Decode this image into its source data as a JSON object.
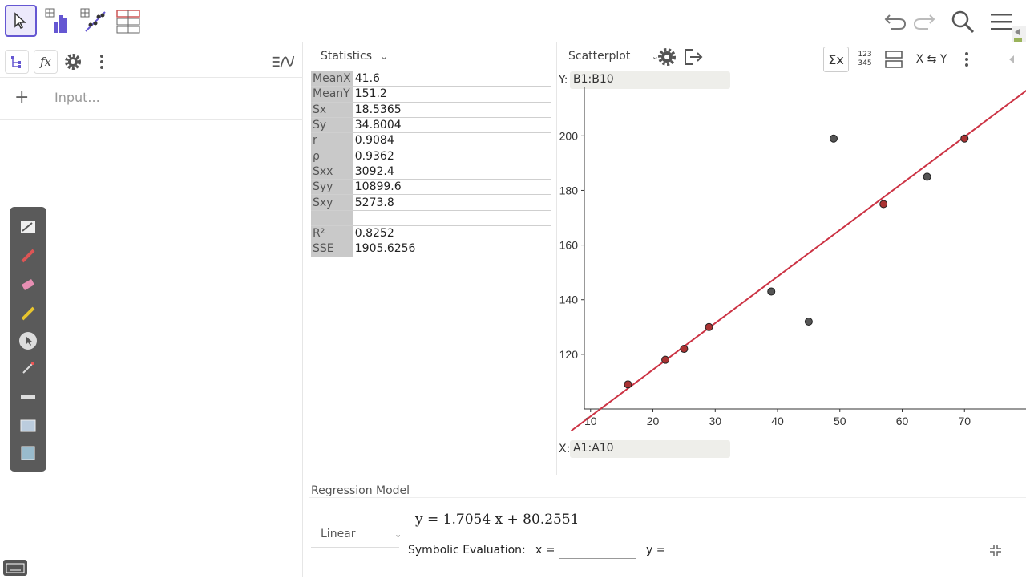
{
  "toolbar": {
    "tools": [
      "move-tool",
      "one-variable-tool",
      "two-variable-tool",
      "multi-variable-tool"
    ],
    "right": [
      "undo",
      "redo",
      "search",
      "menu"
    ]
  },
  "algebra": {
    "input_placeholder": "Input..."
  },
  "statistics": {
    "title": "Statistics",
    "rows": [
      {
        "label": "MeanX",
        "value": "41.6"
      },
      {
        "label": "MeanY",
        "value": "151.2"
      },
      {
        "label": "Sx",
        "value": "18.5365"
      },
      {
        "label": "Sy",
        "value": "34.8004"
      },
      {
        "label": "r",
        "value": "0.9084"
      },
      {
        "label": "ρ",
        "value": "0.9362"
      },
      {
        "label": "Sxx",
        "value": "3092.4"
      },
      {
        "label": "Syy",
        "value": "10899.6"
      },
      {
        "label": "Sxy",
        "value": "5273.8"
      },
      {
        "label": "",
        "value": ""
      },
      {
        "label": "R²",
        "value": "0.8252"
      },
      {
        "label": "SSE",
        "value": "1905.6256"
      }
    ]
  },
  "plot": {
    "title": "Scatterplot",
    "y_label": "Y:",
    "y_range": "B1:B10",
    "x_label": "X:",
    "x_range": "A1:A10",
    "swap_label": "X ⇆ Y",
    "sigma_label": "Σx",
    "number_icon_line1": "123",
    "number_icon_line2": "345"
  },
  "chart_data": {
    "type": "scatter",
    "x": [
      16,
      22,
      25,
      29,
      39,
      45,
      49,
      57,
      64,
      70
    ],
    "y": [
      109,
      118,
      122,
      130,
      143,
      132,
      199,
      175,
      185,
      199
    ],
    "xlim": [
      9,
      80
    ],
    "ylim": [
      100,
      218
    ],
    "x_ticks": [
      10,
      20,
      30,
      40,
      50,
      60,
      70
    ],
    "y_ticks": [
      120,
      140,
      160,
      180,
      200
    ],
    "regression": {
      "slope": 1.7054,
      "intercept": 80.2551
    },
    "colors": {
      "line": "#cc3344",
      "point": "#555555",
      "point_on_line": "#aa3333"
    }
  },
  "regression": {
    "title": "Regression Model",
    "model": "Linear",
    "equation": "y = 1.7054 x + 80.2551",
    "symbolic_label": "Symbolic Evaluation:",
    "x_eq": "x =",
    "y_eq": "y ="
  }
}
